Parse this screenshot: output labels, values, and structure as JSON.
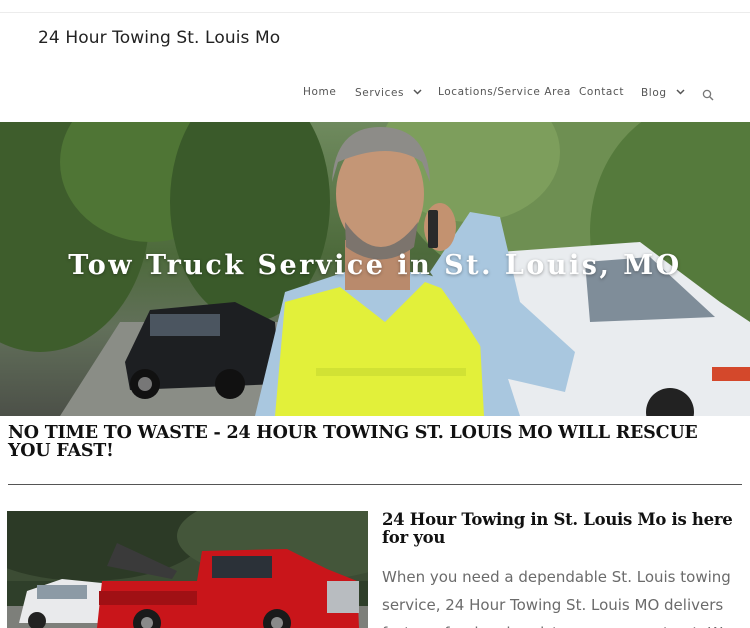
{
  "site": {
    "title": "24 Hour Towing St. Louis Mo"
  },
  "nav": {
    "items": [
      {
        "label": "Home"
      },
      {
        "label": "Services"
      },
      {
        "label": "Locations/Service Area"
      },
      {
        "label": "Contact"
      },
      {
        "label": "Blog"
      }
    ]
  },
  "hero": {
    "title": "Tow Truck Service in St. Louis, MO"
  },
  "section": {
    "heading": "NO TIME TO WASTE - 24 HOUR TOWING ST. LOUIS MO WILL RESCUE YOU FAST!"
  },
  "card": {
    "heading": "24 Hour Towing in St. Louis Mo is here for you",
    "body": "When you need a dependable St. Louis towing service, 24 Hour Towing St. Louis MO delivers fast, professional assistance you can trust. We"
  },
  "icons": {
    "services_chevron": "chevron-down-icon",
    "blog_chevron": "chevron-down-icon",
    "search": "search-icon"
  },
  "colors": {
    "vest": "#e4f23a",
    "tow_truck": "#c9151a"
  }
}
